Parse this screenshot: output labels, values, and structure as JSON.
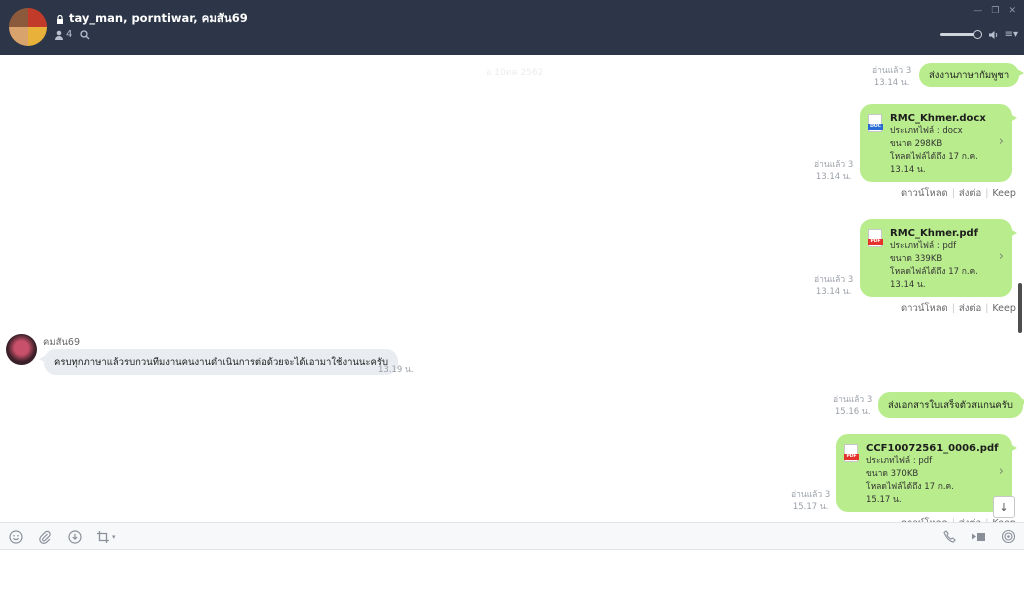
{
  "header": {
    "title": "tay_man, porntiwar, คมสัน69",
    "member_count": "4"
  },
  "chat": {
    "faded_date": "อ 10ตค 2562",
    "messages": [
      {
        "read": "อ่านแล้ว 3",
        "time": "13.14 น.",
        "text": "ส่งงานภาษากัมพูชา"
      },
      {
        "read": "อ่านแล้ว 3",
        "time": "13.14 น.",
        "file": {
          "name": "RMC_Khmer.docx",
          "badge": "DOC",
          "type": "ประเภทไฟล์ : docx",
          "size": "ขนาด 298KB",
          "valid": "โหลดไฟล์ได้ถึง 17 ก.ค.",
          "valid_time": "13.14 น."
        }
      },
      {
        "read": "อ่านแล้ว 3",
        "time": "13.14 น.",
        "file": {
          "name": "RMC_Khmer.pdf",
          "badge": "PDF",
          "type": "ประเภทไฟล์ : pdf",
          "size": "ขนาด 339KB",
          "valid": "โหลดไฟล์ได้ถึง 17 ก.ค.",
          "valid_time": "13.14 น."
        }
      },
      {
        "sender": "คมสัน69",
        "text": "ครบทุกภาษาแล้วรบกวนทีมงานคนงานดำเนินการต่อด้วยจะได้เอามาใช้งานนะครับ",
        "time": "13.19 น."
      },
      {
        "read": "อ่านแล้ว 3",
        "time": "15.16 น.",
        "text": "ส่งเอกสารใบเสร็จตัวสแกนครับ"
      },
      {
        "read": "อ่านแล้ว 3",
        "time": "15.17 น.",
        "file": {
          "name": "CCF10072561_0006.pdf",
          "badge": "PDF",
          "type": "ประเภทไฟล์ : pdf",
          "size": "ขนาด 370KB",
          "valid": "โหลดไฟล์ได้ถึง 17 ก.ค.",
          "valid_time": "15.17 น."
        }
      }
    ],
    "actions": {
      "download": "ดาวน์โหลด",
      "forward": "ส่งต่อ",
      "keep": "Keep"
    }
  },
  "icons": {
    "lock": "lock-icon",
    "members": "person-icon",
    "search": "search-icon",
    "minimize": "minimize-icon",
    "restore": "restore-icon",
    "close": "close-icon",
    "speaker": "speaker-icon",
    "menu": "menu-icon",
    "emoji": "emoji-icon",
    "attach": "paperclip-icon",
    "keep": "download-circle-icon",
    "crop": "crop-icon",
    "call": "phone-icon",
    "video": "video-icon",
    "live": "live-icon",
    "scroll": "arrow-down-icon"
  },
  "colors": {
    "header_bg": "#2d3648",
    "outgoing_bubble": "#b8ec8c",
    "incoming_bubble": "#e9ecf0",
    "pdf_badge": "#e5322d",
    "doc_badge": "#2b6cd4"
  }
}
